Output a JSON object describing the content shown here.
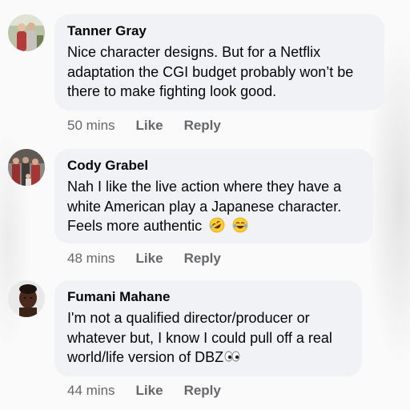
{
  "comments": [
    {
      "author": "Tanner Gray",
      "text": "Nice character designs. But for a Netflix adaptation the CGI budget probably won’t be there to make fighting look good.",
      "time": "50 mins",
      "like_label": "Like",
      "reply_label": "Reply"
    },
    {
      "author": "Cody Grabel",
      "text": "Nah I like the live action where they have a white American play a Japanese character. Feels more authentic",
      "emojis": [
        "rolling-on-floor-laughing-emoji",
        "tears-of-joy-emoji"
      ],
      "time": "48 mins",
      "like_label": "Like",
      "reply_label": "Reply"
    },
    {
      "author": "Fumani Mahane",
      "text": "I'm not a qualified director/producer or whatever but, I know I could pull off a real world/life version of DBZ",
      "emojis": [
        "eyes-emoji"
      ],
      "time": "44 mins",
      "like_label": "Like",
      "reply_label": "Reply"
    }
  ],
  "colors": {
    "bubble": "#f0f2f5",
    "text": "#050505",
    "meta": "#65676b"
  }
}
